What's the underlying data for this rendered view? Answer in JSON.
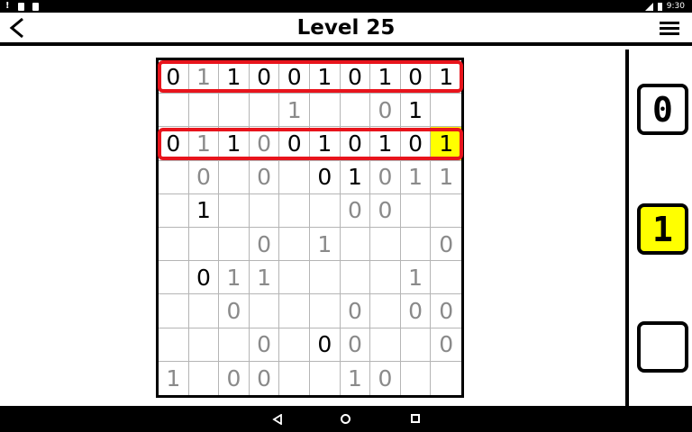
{
  "status_bar": {
    "time": "9:30",
    "left_icons": [
      "alert-icon",
      "chat-icon",
      "clipboard-icon"
    ],
    "right_icons": [
      "signal-icon",
      "battery-icon"
    ]
  },
  "header": {
    "title": "Level 25",
    "back_icon": "chevron-left-icon",
    "menu_icon": "hamburger-icon"
  },
  "grid": {
    "rows": [
      [
        "0",
        "1",
        "1",
        "0",
        "0",
        "1",
        "0",
        "1",
        "0",
        "1"
      ],
      [
        "",
        "",
        "",
        "",
        "1",
        "",
        "",
        "0",
        "1",
        ""
      ],
      [
        "0",
        "1",
        "1",
        "0",
        "0",
        "1",
        "0",
        "1",
        "0",
        "1"
      ],
      [
        "",
        "0",
        "",
        "0",
        "",
        "0",
        "1",
        "0",
        "1",
        "1"
      ],
      [
        "",
        "1",
        "",
        "",
        "",
        "",
        "0",
        "0",
        "",
        ""
      ],
      [
        "",
        "",
        "",
        "0",
        "",
        "1",
        "",
        "",
        "",
        "0"
      ],
      [
        "",
        "0",
        "1",
        "1",
        "",
        "",
        "",
        "",
        "1",
        ""
      ],
      [
        "",
        "",
        "0",
        "",
        "",
        "",
        "0",
        "",
        "0",
        "0"
      ],
      [
        "",
        "",
        "",
        "0",
        "",
        "0",
        "0",
        "",
        "",
        "0"
      ],
      [
        "1",
        "",
        "0",
        "0",
        "",
        "",
        "1",
        "0",
        "",
        ""
      ]
    ],
    "styles": [
      [
        "f",
        "p",
        "f",
        "f",
        "f",
        "f",
        "f",
        "f",
        "f",
        "f"
      ],
      [
        "",
        "",
        "",
        "",
        "p",
        "",
        "",
        "p",
        "f",
        ""
      ],
      [
        "f",
        "p",
        "f",
        "p",
        "f",
        "f",
        "f",
        "f",
        "f",
        "h"
      ],
      [
        "",
        "p",
        "",
        "p",
        "",
        "f",
        "f",
        "p",
        "p",
        "p"
      ],
      [
        "",
        "f",
        "",
        "",
        "",
        "",
        "p",
        "p",
        "",
        ""
      ],
      [
        "",
        "",
        "",
        "p",
        "",
        "p",
        "",
        "",
        "",
        "p"
      ],
      [
        "",
        "f",
        "p",
        "p",
        "",
        "",
        "",
        "",
        "p",
        ""
      ],
      [
        "",
        "",
        "p",
        "",
        "",
        "",
        "p",
        "",
        "p",
        "p"
      ],
      [
        "",
        "",
        "",
        "p",
        "",
        "f",
        "p",
        "",
        "",
        "p"
      ],
      [
        "p",
        "",
        "p",
        "p",
        "",
        "",
        "p",
        "p",
        "",
        ""
      ]
    ],
    "highlighted_rows": [
      0,
      2
    ],
    "selected_cell": {
      "row": 2,
      "col": 9
    }
  },
  "side_panel": {
    "tiles": [
      {
        "label": "0",
        "active": false
      },
      {
        "label": "1",
        "active": true
      },
      {
        "label": "",
        "active": false
      }
    ]
  },
  "nav_bar": {
    "icons": [
      "back-triangle-icon",
      "home-circle-icon",
      "recents-square-icon"
    ]
  },
  "colors": {
    "highlight": "#ffff00",
    "row_marker": "#e8141c",
    "fixed_digit": "#000000",
    "placed_digit": "#8a8a8a"
  }
}
